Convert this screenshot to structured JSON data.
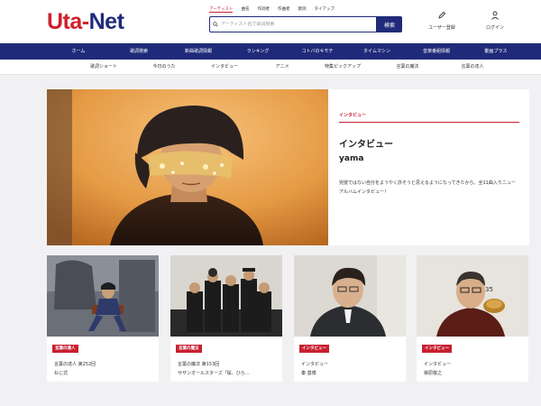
{
  "logo": {
    "part1": "Uta-",
    "part2": "Net"
  },
  "search": {
    "tabs": [
      "アーティスト",
      "曲名",
      "作詞者",
      "作曲者",
      "歌詞",
      "タイアップ"
    ],
    "placeholder": "アーティスト名で歌詞検索",
    "button_label": "検索"
  },
  "header_actions": {
    "register": "ユーザー登録",
    "login": "ログイン"
  },
  "main_nav": [
    "ホーム",
    "歌詞検索",
    "新曲歌詞情報",
    "ランキング",
    "コトバのキモチ",
    "タイムマシン",
    "音楽番組情報",
    "動画プラス"
  ],
  "sub_nav": [
    "歌詞ショート",
    "今日のうた",
    "インタビュー",
    "アニメ",
    "特集ピックアップ",
    "言葉の魔法",
    "言葉の達人"
  ],
  "feature": {
    "category": "インタビュー",
    "title": "インタビュー",
    "artist": "yama",
    "description": "完璧ではない自分をようやく許そうと思えるようになってきたから。全11曲入りニューアルバムインタビュー！"
  },
  "cards": [
    {
      "tag": "言葉の達人",
      "line1": "言葉の達人 第252回",
      "line2": "ねじ式"
    },
    {
      "tag": "言葉の魔法",
      "line1": "言葉の魔法 第153回",
      "line2": "サザンオールスターズ「桜、ひら…"
    },
    {
      "tag": "インタビュー",
      "line1": "インタビュー",
      "line2": "秦 基博"
    },
    {
      "tag": "インタビュー",
      "line1": "インタビュー",
      "line2": "槇原敬之"
    }
  ],
  "colors": {
    "brand_red": "#c82030",
    "brand_navy": "#1f2b7a"
  }
}
